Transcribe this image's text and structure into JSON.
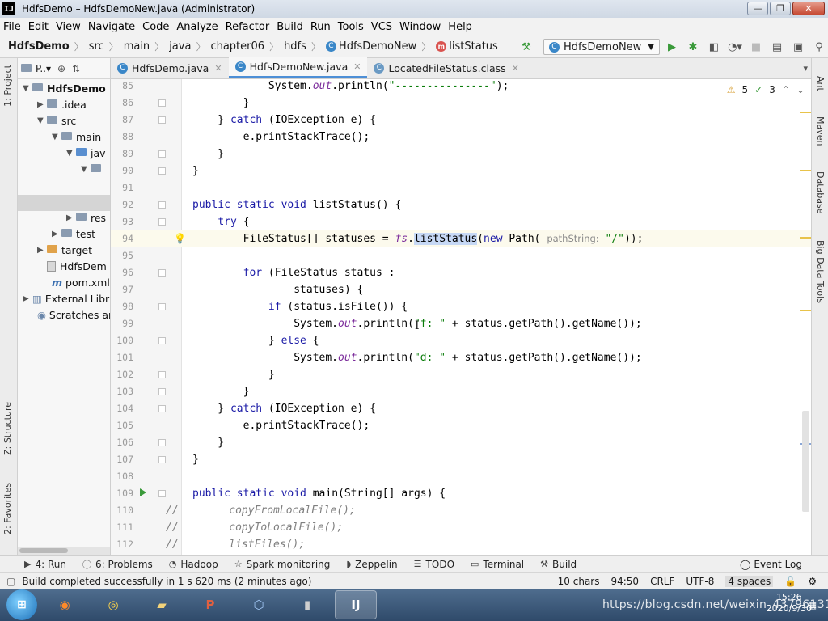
{
  "window": {
    "app_icon": "IJ",
    "title": "HdfsDemo – HdfsDemoNew.java (Administrator)",
    "buttons": {
      "minimize": "—",
      "maximize": "❐",
      "close": "✕"
    }
  },
  "menu": [
    "File",
    "Edit",
    "View",
    "Navigate",
    "Code",
    "Analyze",
    "Refactor",
    "Build",
    "Run",
    "Tools",
    "VCS",
    "Window",
    "Help"
  ],
  "breadcrumb": {
    "items": [
      "HdfsDemo",
      "src",
      "main",
      "java",
      "chapter06",
      "hdfs",
      "HdfsDemoNew",
      "listStatus"
    ],
    "separator": "〉"
  },
  "run_config": {
    "name": "HdfsDemoNew"
  },
  "left_stripe": {
    "project": "1: Project",
    "structure": "Z: Structure",
    "favorites": "2: Favorites"
  },
  "project_panel": {
    "header": "P..▾",
    "tree": [
      "HdfsDemo",
      ".idea",
      "src",
      "main",
      "jav",
      "",
      "res",
      "test",
      "target",
      "HdfsDem",
      "pom.xml",
      "External Libr",
      "Scratches ar"
    ]
  },
  "editor_tabs": [
    {
      "label": "HdfsDemo.java",
      "active": false
    },
    {
      "label": "HdfsDemoNew.java",
      "active": true
    },
    {
      "label": "LocatedFileStatus.class",
      "active": false
    }
  ],
  "inspection": {
    "warnings": "5",
    "weak_warnings": "3"
  },
  "code_lines": [
    {
      "num": "85",
      "text": "            System.out.println(\"---------------\");"
    },
    {
      "num": "86",
      "text": "        }"
    },
    {
      "num": "87",
      "text": "    } catch (IOException e) {"
    },
    {
      "num": "88",
      "text": "        e.printStackTrace();"
    },
    {
      "num": "89",
      "text": "    }"
    },
    {
      "num": "90",
      "text": "}"
    },
    {
      "num": "91",
      "text": ""
    },
    {
      "num": "92",
      "text": "public static void listStatus() {"
    },
    {
      "num": "93",
      "text": "    try {"
    },
    {
      "num": "94",
      "text": "        FileStatus[] statuses = fs.listStatus(new Path( pathString: \"/\"));"
    },
    {
      "num": "95",
      "text": ""
    },
    {
      "num": "96",
      "text": "        for (FileStatus status :"
    },
    {
      "num": "97",
      "text": "                statuses) {"
    },
    {
      "num": "98",
      "text": "            if (status.isFile()) {"
    },
    {
      "num": "99",
      "text": "                System.out.println(\"f: \" + status.getPath().getName());"
    },
    {
      "num": "100",
      "text": "            } else {"
    },
    {
      "num": "101",
      "text": "                System.out.println(\"d: \" + status.getPath().getName());"
    },
    {
      "num": "102",
      "text": "            }"
    },
    {
      "num": "103",
      "text": "        }"
    },
    {
      "num": "104",
      "text": "    } catch (IOException e) {"
    },
    {
      "num": "105",
      "text": "        e.printStackTrace();"
    },
    {
      "num": "106",
      "text": "    }"
    },
    {
      "num": "107",
      "text": "}"
    },
    {
      "num": "108",
      "text": ""
    },
    {
      "num": "109",
      "text": "public static void main(String[] args) {"
    },
    {
      "num": "110",
      "text": "//        copyFromLocalFile();"
    },
    {
      "num": "111",
      "text": "//        copyToLocalFile();"
    },
    {
      "num": "112",
      "text": "//        listFiles();"
    }
  ],
  "right_stripe": {
    "ant": "Ant",
    "maven": "Maven",
    "database": "Database",
    "bigdata": "Big Data Tools"
  },
  "bottom_tools": [
    "4: Run",
    "6: Problems",
    "Hadoop",
    "Spark monitoring",
    "Zeppelin",
    "TODO",
    "Terminal",
    "Build"
  ],
  "event_log": "Event Log",
  "status": {
    "message": "Build completed successfully in 1 s 620 ms (2 minutes ago)",
    "chars": "10 chars",
    "position": "94:50",
    "line_sep": "CRLF",
    "encoding": "UTF-8",
    "indent": "4 spaces"
  },
  "taskbar": {
    "apps": [
      "Firefox",
      "Chrome",
      "Explorer",
      "PowerPoint",
      "VirtualBox",
      "Terminal",
      "IntelliJ IDEA"
    ],
    "watermark": "https://blog.csdn.net/weixin_43796131",
    "clock": {
      "time": "15:26",
      "date": "2020/9/30"
    }
  },
  "colors": {
    "keyword": "#1a1aa6",
    "string": "#0a7d0a",
    "field": "#7a2a9a",
    "comment": "#808080",
    "selection": "#c6d8f5",
    "active_tab": "#4d8fd6"
  }
}
